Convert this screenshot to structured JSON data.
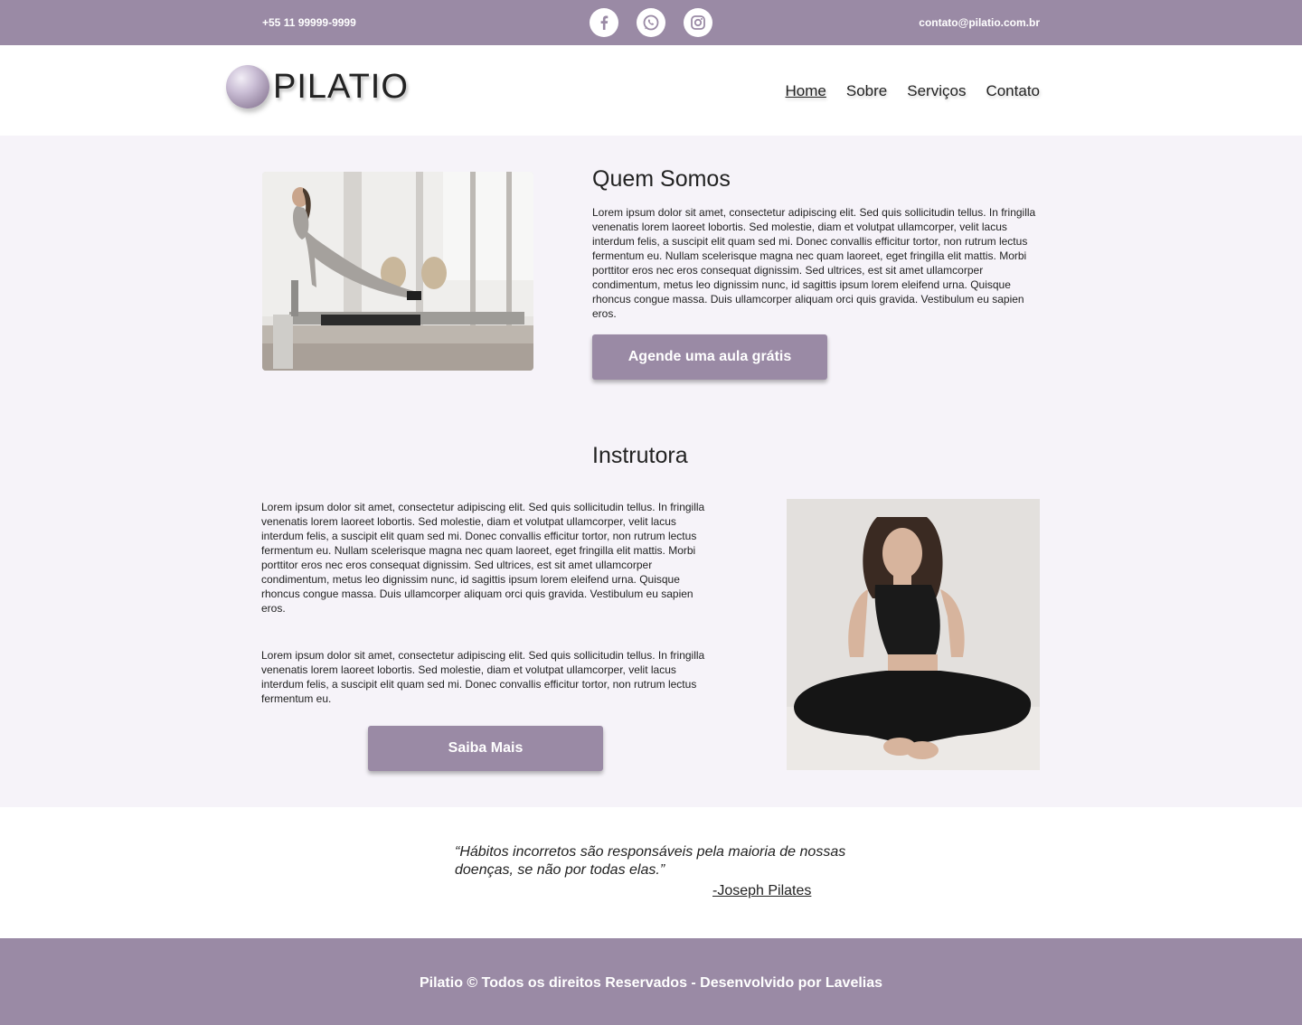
{
  "topbar": {
    "phone": "+55 11 99999-9999",
    "email": "contato@pilatio.com.br",
    "social": [
      {
        "icon": "facebook-icon"
      },
      {
        "icon": "whatsapp-icon"
      },
      {
        "icon": "instagram-icon"
      }
    ]
  },
  "header": {
    "logo_text": "PILATIO",
    "nav": [
      {
        "label": "Home",
        "active": true
      },
      {
        "label": "Sobre",
        "active": false
      },
      {
        "label": "Serviços",
        "active": false
      },
      {
        "label": "Contato",
        "active": false
      }
    ]
  },
  "about": {
    "title": "Quem Somos",
    "text": "Lorem ipsum dolor sit amet, consectetur adipiscing elit. Sed quis sollicitudin tellus. In fringilla venenatis lorem laoreet lobortis. Sed molestie, diam et volutpat ullamcorper, velit lacus interdum felis, a suscipit elit quam sed mi. Donec convallis efficitur tortor, non rutrum lectus fermentum eu. Nullam scelerisque magna nec quam laoreet, eget fringilla elit mattis. Morbi porttitor eros nec eros consequat dignissim. Sed ultrices, est sit amet ullamcorper condimentum, metus leo dignissim nunc, id sagittis ipsum lorem eleifend urna. Quisque rhoncus congue massa. Duis ullamcorper aliquam orci quis gravida. Vestibulum eu sapien eros.",
    "button": "Agende uma aula grátis"
  },
  "instructor": {
    "title": "Instrutora",
    "text1": "Lorem ipsum dolor sit amet, consectetur adipiscing elit. Sed quis sollicitudin tellus. In fringilla venenatis lorem laoreet lobortis. Sed molestie, diam et volutpat ullamcorper, velit lacus interdum felis, a suscipit elit quam sed mi. Donec convallis efficitur tortor, non rutrum lectus fermentum eu. Nullam scelerisque magna nec quam laoreet, eget fringilla elit mattis. Morbi porttitor eros nec eros consequat dignissim. Sed ultrices, est sit amet ullamcorper condimentum, metus leo dignissim nunc, id sagittis ipsum lorem eleifend urna. Quisque rhoncus congue massa. Duis ullamcorper aliquam orci quis gravida. Vestibulum eu sapien eros.",
    "text2": "Lorem ipsum dolor sit amet, consectetur adipiscing elit. Sed quis sollicitudin tellus. In fringilla venenatis lorem laoreet lobortis. Sed molestie, diam et volutpat ullamcorper, velit lacus interdum felis, a suscipit elit quam sed mi. Donec convallis efficitur tortor, non rutrum lectus fermentum eu.",
    "button": "Saiba Mais"
  },
  "quote": {
    "text": "“Hábitos incorretos são responsáveis pela maioria de nossas doenças, se não por todas elas.”",
    "author": "-Joseph Pilates"
  },
  "footer": {
    "text": "Pilatio © Todos os direitos Reservados - Desenvolvido por Lavelias"
  },
  "colors": {
    "accent": "#9a8aa5",
    "section_bg": "#f6f3f9"
  }
}
